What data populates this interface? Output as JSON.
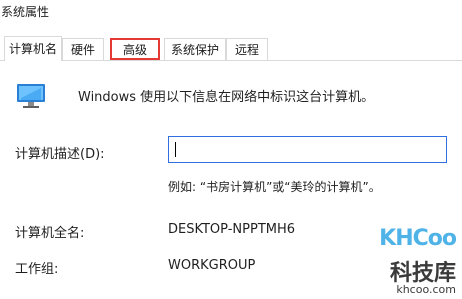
{
  "window": {
    "title": "系统属性"
  },
  "tabs": [
    {
      "label": "计算机名"
    },
    {
      "label": "硬件"
    },
    {
      "label": "高级"
    },
    {
      "label": "系统保护"
    },
    {
      "label": "远程"
    }
  ],
  "main": {
    "description": "Windows 使用以下信息在网络中标识这台计算机。",
    "computer_desc_label": "计算机描述(D):",
    "computer_desc_value": "",
    "example": "例如: “书房计算机”或“美玲的计算机”。",
    "full_name_label": "计算机全名:",
    "full_name_value": "DESKTOP-NPPTMH6",
    "workgroup_label": "工作组:",
    "workgroup_value": "WORKGROUP"
  },
  "watermark": {
    "logo": "KHCoo",
    "cn": "科技库",
    "url": "khcoo.com"
  },
  "colors": {
    "highlight": "#e53935",
    "input_border": "#2f6fdf",
    "watermark_blue": "#4fb3e8"
  }
}
